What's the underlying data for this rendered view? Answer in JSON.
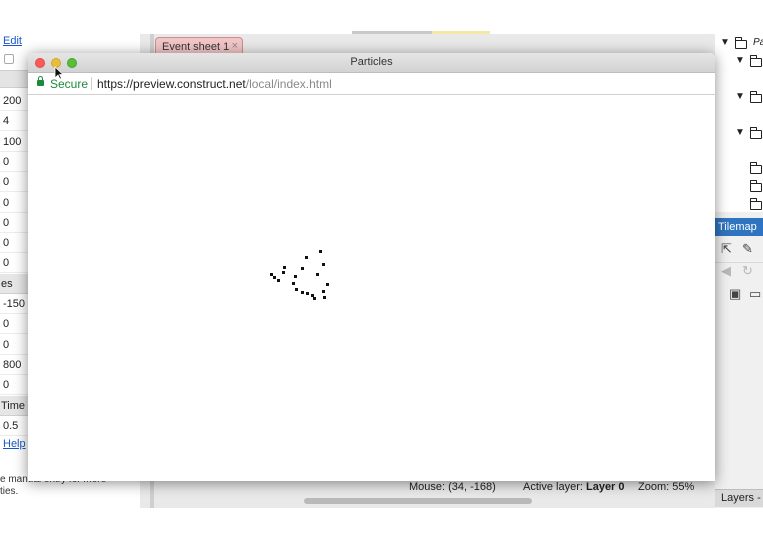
{
  "left_panel": {
    "edit_link": "Edit",
    "properties": [
      {
        "kind": "value",
        "text": "200"
      },
      {
        "kind": "value",
        "text": "4"
      },
      {
        "kind": "value",
        "text": "100"
      },
      {
        "kind": "value",
        "text": "0"
      },
      {
        "kind": "value",
        "text": "0"
      },
      {
        "kind": "value",
        "text": "0"
      },
      {
        "kind": "value",
        "text": "0"
      },
      {
        "kind": "value",
        "text": "0"
      },
      {
        "kind": "value",
        "text": "0"
      },
      {
        "kind": "group",
        "text": "es"
      },
      {
        "kind": "value",
        "text": "-150"
      },
      {
        "kind": "value",
        "text": "0"
      },
      {
        "kind": "value",
        "text": "0"
      },
      {
        "kind": "value",
        "text": "800"
      },
      {
        "kind": "value",
        "text": "0"
      },
      {
        "kind": "group",
        "text": "Time"
      },
      {
        "kind": "value",
        "text": "0.5"
      }
    ],
    "help_link": "Help",
    "description_line1": "e manual entry for more",
    "description_line2": "ties."
  },
  "editor": {
    "tab_label": "Event sheet 1",
    "tab_close": "×",
    "status": {
      "mouse": "Mouse: (34, -168)",
      "active_layer_label": "Active layer:",
      "active_layer_value": "Layer 0",
      "zoom": "Zoom: 55%"
    }
  },
  "right_panel": {
    "tree_label": "Pa",
    "tilemap_title": "Tilemap",
    "layers_tab": "Layers -"
  },
  "browser": {
    "window_title": "Particles",
    "secure_label": "Secure",
    "url_scheme_host": "https://preview.construct.net",
    "url_path": "/local/index.html"
  },
  "icons": {
    "lock": "lock-icon",
    "cursor": "arrow-cursor-icon",
    "folders": "folder-icon",
    "tools": [
      "select-arrow-icon",
      "pencil-icon",
      "erase-icon",
      "rotate-icon",
      "save-icon",
      "open-folder-icon"
    ]
  },
  "colors": {
    "secure_green": "#1c8a3a",
    "tilemap_blue": "#2f74c0",
    "link_blue": "#1a56c9",
    "event_tab_pink": "#f2c6c6"
  }
}
